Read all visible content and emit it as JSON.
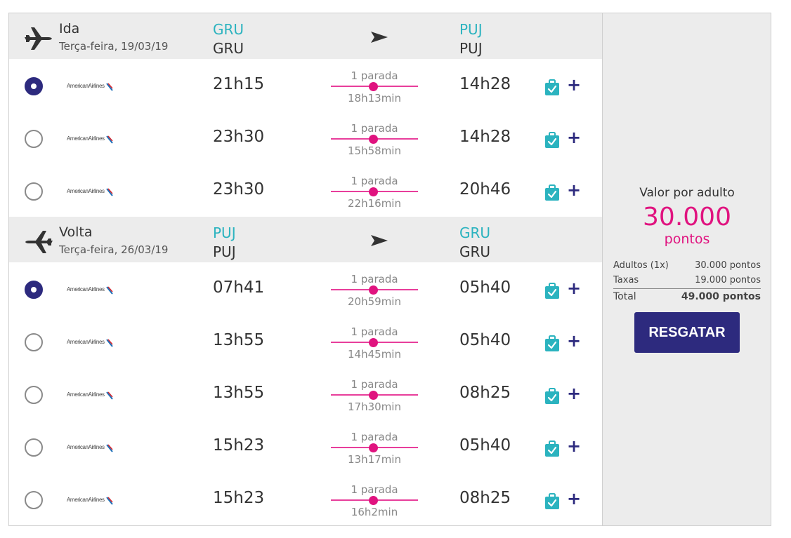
{
  "outbound": {
    "title": "Ida",
    "date": "Terça-feira, 19/03/19",
    "origin_code": "GRU",
    "origin_name": "GRU",
    "destination_code": "PUJ",
    "destination_name": "PUJ",
    "flights": [
      {
        "selected": true,
        "airline": "AmericanAirlines",
        "depart": "21h15",
        "stops": "1 parada",
        "duration": "18h13min",
        "arrive": "14h28"
      },
      {
        "selected": false,
        "airline": "AmericanAirlines",
        "depart": "23h30",
        "stops": "1 parada",
        "duration": "15h58min",
        "arrive": "14h28"
      },
      {
        "selected": false,
        "airline": "AmericanAirlines",
        "depart": "23h30",
        "stops": "1 parada",
        "duration": "22h16min",
        "arrive": "20h46"
      }
    ]
  },
  "inbound": {
    "title": "Volta",
    "date": "Terça-feira, 26/03/19",
    "origin_code": "PUJ",
    "origin_name": "PUJ",
    "destination_code": "GRU",
    "destination_name": "GRU",
    "flights": [
      {
        "selected": true,
        "airline": "AmericanAirlines",
        "depart": "07h41",
        "stops": "1 parada",
        "duration": "20h59min",
        "arrive": "05h40"
      },
      {
        "selected": false,
        "airline": "AmericanAirlines",
        "depart": "13h55",
        "stops": "1 parada",
        "duration": "14h45min",
        "arrive": "05h40"
      },
      {
        "selected": false,
        "airline": "AmericanAirlines",
        "depart": "13h55",
        "stops": "1 parada",
        "duration": "17h30min",
        "arrive": "08h25"
      },
      {
        "selected": false,
        "airline": "AmericanAirlines",
        "depart": "15h23",
        "stops": "1 parada",
        "duration": "13h17min",
        "arrive": "05h40"
      },
      {
        "selected": false,
        "airline": "AmericanAirlines",
        "depart": "15h23",
        "stops": "1 parada",
        "duration": "16h2min",
        "arrive": "08h25"
      }
    ]
  },
  "summary": {
    "label": "Valor por adulto",
    "price": "30.000",
    "unit": "pontos",
    "lines": [
      {
        "label": "Adultos (1x)",
        "value": "30.000 pontos"
      },
      {
        "label": "Taxas",
        "value": "19.000 pontos"
      },
      {
        "label": "Total",
        "value": "49.000 pontos"
      }
    ],
    "button": "RESGATAR"
  },
  "icons": {
    "plane": "plane-icon",
    "arrow": "arrow-right-icon",
    "baggage": "baggage-check-icon",
    "plus": "plus-icon"
  },
  "colors": {
    "accent_teal": "#2bb3bf",
    "accent_pink": "#e0137f",
    "primary_navy": "#2d2a7e",
    "header_bg": "#ececec"
  }
}
